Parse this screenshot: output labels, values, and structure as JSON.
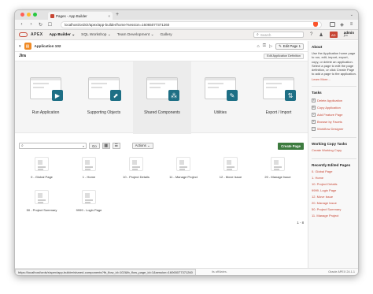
{
  "browser": {
    "tab_title": "Pages - App Builder",
    "tab_close": "×",
    "new_tab": "+",
    "tab_menu": "⌄",
    "url": "localhost/ords/r/apex/app-builder/home?session=16065077371260",
    "status_url": "https://localhost/ords/r/apex/app-builder/shared-components?fb_flow_id=102&fb_flow_page_id=1&session=16065077371260"
  },
  "apex_header": {
    "brand": "APEX",
    "menus": [
      "App Builder ⌄",
      "SQL Workshop ⌄",
      "Team Development ⌄",
      "Gallery"
    ],
    "search_placeholder": "Search",
    "avatar": "AD",
    "user_name": "admin",
    "user_ws": "jira"
  },
  "breadcrumb": {
    "app_name": "Application 102",
    "edit_page": "Edit Page 1"
  },
  "main": {
    "app_title": "Jira",
    "app_def_button": "Edit Application Definition",
    "tiles": [
      {
        "label": "Run Application",
        "badge": "▶"
      },
      {
        "label": "Supporting Objects",
        "badge": "⬈"
      },
      {
        "label": "Shared Components",
        "badge": "⁂"
      },
      {
        "label": "Utilities",
        "badge": "✎"
      },
      {
        "label": "Export / Import",
        "badge": "⇅"
      }
    ],
    "go": "Go",
    "actions": "Actions ⌄",
    "create_page": "Create Page",
    "pages": [
      {
        "label": "0 - Global Page"
      },
      {
        "label": "1 - Home"
      },
      {
        "label": "10 - Project Details"
      },
      {
        "label": "11 - Manage Project"
      },
      {
        "label": "12 - Move Issue"
      },
      {
        "label": "20 - Manage Issue"
      },
      {
        "label": "50 - Project Summary"
      },
      {
        "label": "9999 - Login Page"
      }
    ],
    "pager": "1 - 8"
  },
  "sidebar": {
    "about_heading": "About",
    "about_text": "Use the Application home page to run, edit, import, export, copy, or delete an application. Select a page to edit the page definition, or click Create Page to add a page to the application.",
    "learn_more": "Learn More...",
    "tasks_heading": "Tasks",
    "tasks": [
      "Delete Application",
      "Copy Application",
      "Add Feature Page",
      "Browse by Facets",
      "Workflow Designer"
    ],
    "working_copy_heading": "Working Copy Tasks",
    "working_copy_link": "Create Working Copy",
    "recent_heading": "Recently Edited Pages",
    "recent": [
      "0. Global Page",
      "1. Home",
      "10. Project Details",
      "9999. Login Page",
      "12. Move Issue",
      "20. Manage Issue",
      "50. Project Summary",
      "11. Manage Project"
    ]
  },
  "footer": {
    "affiliates": "its affiliates.",
    "version": "Oracle APEX 24.1.1"
  }
}
